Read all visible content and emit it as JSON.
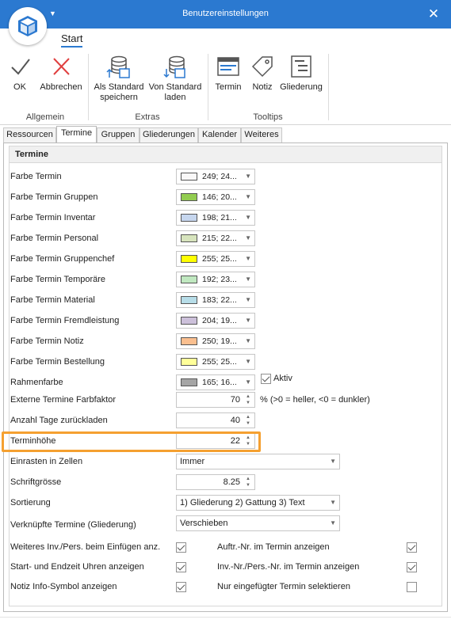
{
  "window": {
    "title": "Benutzereinstellungen",
    "close_glyph": "✕",
    "qat_glyph": "▼"
  },
  "ribbon": {
    "tab_label": "Start",
    "groups": [
      {
        "label": "Allgemein",
        "buttons": [
          {
            "label": "OK",
            "icon": "checkmark-icon"
          },
          {
            "label": "Abbrechen",
            "icon": "cross-icon"
          }
        ]
      },
      {
        "label": "Extras",
        "buttons": [
          {
            "label_line1": "Als Standard",
            "label_line2": "speichern",
            "icon": "database-save-icon"
          },
          {
            "label_line1": "Von Standard",
            "label_line2": "laden",
            "icon": "database-load-icon"
          }
        ]
      },
      {
        "label": "Tooltips",
        "buttons": [
          {
            "label": "Termin",
            "icon": "calendar-icon"
          },
          {
            "label": "Notiz",
            "icon": "tag-icon"
          },
          {
            "label": "Gliederung",
            "icon": "outline-icon"
          }
        ]
      }
    ]
  },
  "tabs": [
    "Ressourcen",
    "Termine",
    "Gruppen",
    "Gliederungen",
    "Kalender",
    "Weiteres"
  ],
  "active_tab": "Termine",
  "section_title": "Termine",
  "color_rows": [
    {
      "label": "Farbe Termin",
      "value": "249; 24...",
      "color": "#f9f8f8"
    },
    {
      "label": "Farbe Termin Gruppen",
      "value": "146; 20...",
      "color": "#92cc50"
    },
    {
      "label": "Farbe Termin Inventar",
      "value": "198; 21...",
      "color": "#c6d6ee"
    },
    {
      "label": "Farbe Termin Personal",
      "value": "215; 22...",
      "color": "#d7e4bd"
    },
    {
      "label": "Farbe Termin Gruppenchef",
      "value": "255; 25...",
      "color": "#ffff00"
    },
    {
      "label": "Farbe Termin Temporäre",
      "value": "192; 23...",
      "color": "#c0e8c0"
    },
    {
      "label": "Farbe Termin Material",
      "value": "183; 22...",
      "color": "#b7dde8"
    },
    {
      "label": "Farbe Termin Fremdleistung",
      "value": "204; 19...",
      "color": "#ccc0da"
    },
    {
      "label": "Farbe Termin Notiz",
      "value": "250; 19...",
      "color": "#fabf8f"
    },
    {
      "label": "Farbe Termin Bestellung",
      "value": "255; 25...",
      "color": "#ffff99"
    },
    {
      "label": "Rahmenfarbe",
      "value": "165; 16...",
      "color": "#a5a5a5"
    }
  ],
  "rahmen_aktiv": {
    "label": "Aktiv",
    "checked": true
  },
  "farbfaktor": {
    "label": "Externe Termine Farbfaktor",
    "value": "70",
    "hint": "% (>0 = heller, <0 = dunkler)"
  },
  "tage_zurueck": {
    "label": "Anzahl Tage zurückladen",
    "value": "40"
  },
  "terminhoehe": {
    "label": "Terminhöhe",
    "value": "22"
  },
  "einrasten": {
    "label": "Einrasten in Zellen",
    "value": "Immer"
  },
  "schriftgroesse": {
    "label": "Schriftgrösse",
    "value": "8.25"
  },
  "sortierung": {
    "label": "Sortierung",
    "value": "1) Gliederung 2) Gattung 3) Text"
  },
  "verknuepfte": {
    "label": "Verknüpfte Termine (Gliederung)",
    "value": "Verschieben"
  },
  "options_left": [
    {
      "label": "Weiteres Inv./Pers. beim Einfügen anz.",
      "checked": true
    },
    {
      "label": "Start- und Endzeit Uhren anzeigen",
      "checked": true
    },
    {
      "label": "Notiz Info-Symbol anzeigen",
      "checked": true
    }
  ],
  "options_right": [
    {
      "label": "Auftr.-Nr. im Termin anzeigen",
      "checked": true
    },
    {
      "label": "Inv.-Nr./Pers.-Nr. im Termin anzeigen",
      "checked": true
    },
    {
      "label": "Nur eingefügter Termin selektieren",
      "checked": false
    }
  ],
  "colors": {
    "titlebar": "#2b79d0",
    "highlight": "#f5a030"
  }
}
